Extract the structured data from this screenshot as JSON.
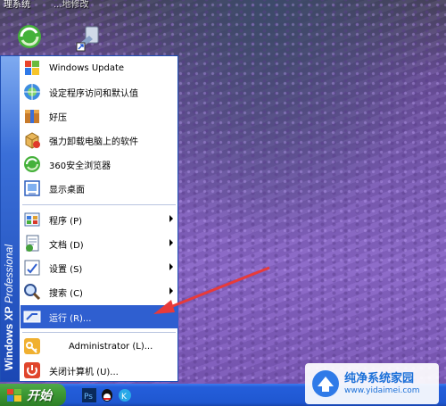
{
  "desktop": {
    "top_title_1": "理系统",
    "top_title_2": "...地修改",
    "icons": [
      "360-browser-shortcut-icon",
      "shortcut-icon"
    ]
  },
  "start_menu": {
    "banner_bold": "Windows XP",
    "banner_light": " Professional",
    "pinned": [
      {
        "label": "Windows Update",
        "icon": "windows-update-icon"
      },
      {
        "label": "设定程序访问和默认值",
        "icon": "set-program-access-icon"
      },
      {
        "label": "好压",
        "icon": "haozip-icon"
      },
      {
        "label": "强力卸载电脑上的软件",
        "icon": "uninstaller-icon"
      },
      {
        "label": "360安全浏览器",
        "icon": "360-browser-icon"
      },
      {
        "label": "显示桌面",
        "icon": "show-desktop-icon"
      }
    ],
    "submenus": [
      {
        "label": "程序 (P)",
        "icon": "programs-icon"
      },
      {
        "label": "文档 (D)",
        "icon": "documents-icon"
      },
      {
        "label": "设置 (S)",
        "icon": "settings-icon"
      },
      {
        "label": "搜索 (C)",
        "icon": "search-icon"
      }
    ],
    "run": {
      "label": "运行 (R)...",
      "icon": "run-icon"
    },
    "logoff": {
      "label": "Administrator (L)...",
      "icon": "logoff-key-icon"
    },
    "shutdown": {
      "label": "关闭计算机 (U)...",
      "icon": "shutdown-icon"
    }
  },
  "taskbar": {
    "start_label": "开始",
    "quick_launch": [
      "photoshop-icon",
      "qq-icon",
      "browser-icon"
    ]
  },
  "watermark": {
    "title": "纯净系统家园",
    "url": "www.yidaimei.com"
  },
  "colors": {
    "start_green": "#3e9a35",
    "taskbar_blue": "#245edb",
    "selection_blue": "#2f5fd0",
    "annotation_red": "#e83a3a"
  }
}
